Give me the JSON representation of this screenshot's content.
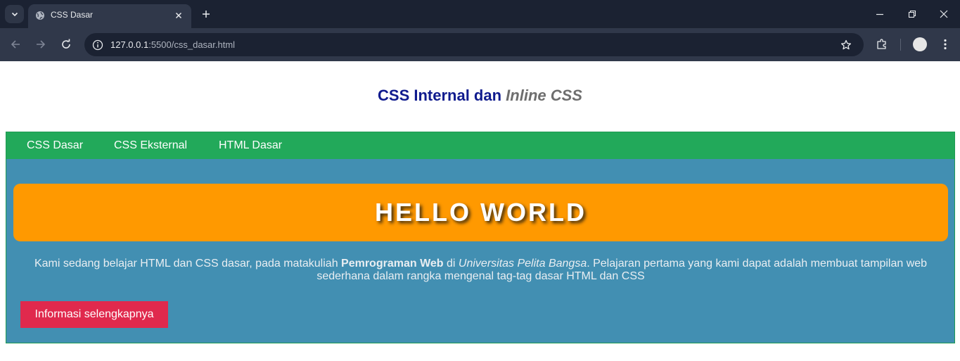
{
  "browser": {
    "tab_title": "CSS Dasar",
    "url_host": "127.0.0.1",
    "url_rest": ":5500/css_dasar.html"
  },
  "page": {
    "title_prefix": "CSS Internal dan ",
    "title_emph": "Inline CSS",
    "nav": [
      {
        "label": "CSS Dasar"
      },
      {
        "label": "CSS Eksternal"
      },
      {
        "label": "HTML Dasar"
      }
    ],
    "hero_heading": "HELLO WORLD",
    "desc_part1": "Kami sedang belajar HTML dan CSS dasar, pada matakuliah ",
    "desc_bold": "Pemrograman Web",
    "desc_part2": " di ",
    "desc_italic": "Universitas Pelita Bangsa",
    "desc_part3": ". Pelajaran pertama yang kami dapat adalah membuat tampilan web sederhana dalam rangka mengenal tag-tag dasar HTML dan CSS",
    "cta_label": "Informasi selengkapnya"
  },
  "colors": {
    "navbar": "#22a95a",
    "content_bg": "#428fb2",
    "hero_bg": "#ff9900",
    "cta_bg": "#e0294d",
    "title": "#101b8e"
  }
}
